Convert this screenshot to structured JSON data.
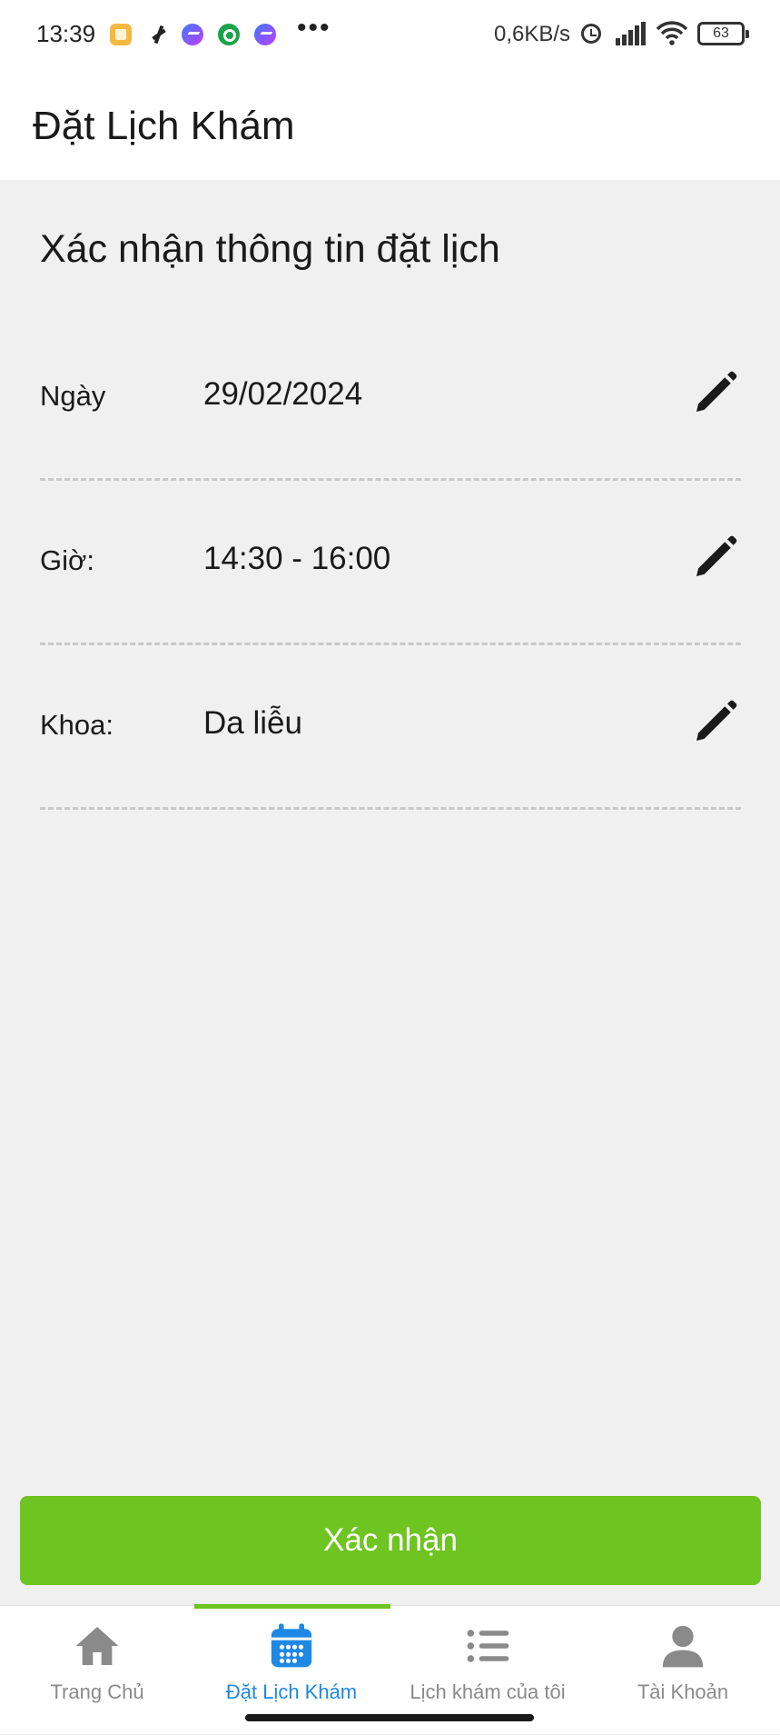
{
  "status_bar": {
    "time": "13:39",
    "more": "•••",
    "net_speed": "0,6KB/s",
    "battery": "63"
  },
  "header": {
    "title": "Đặt Lịch Khám"
  },
  "main": {
    "section_title": "Xác nhận thông tin đặt lịch",
    "rows": [
      {
        "label": "Ngày",
        "value": "29/02/2024"
      },
      {
        "label": "Giờ:",
        "value": "14:30 - 16:00"
      },
      {
        "label": "Khoa:",
        "value": "Da liễu"
      }
    ],
    "confirm_label": "Xác nhận"
  },
  "nav": {
    "items": [
      {
        "label": "Trang Chủ",
        "icon": "home-icon"
      },
      {
        "label": "Đặt Lịch Khám",
        "icon": "calendar-icon"
      },
      {
        "label": "Lịch khám của tôi",
        "icon": "list-icon"
      },
      {
        "label": "Tài Khoản",
        "icon": "user-icon"
      }
    ]
  },
  "colors": {
    "accent_green": "#6ec420",
    "active_blue": "#1e88e5",
    "inactive_gray": "#8a8a8a"
  }
}
